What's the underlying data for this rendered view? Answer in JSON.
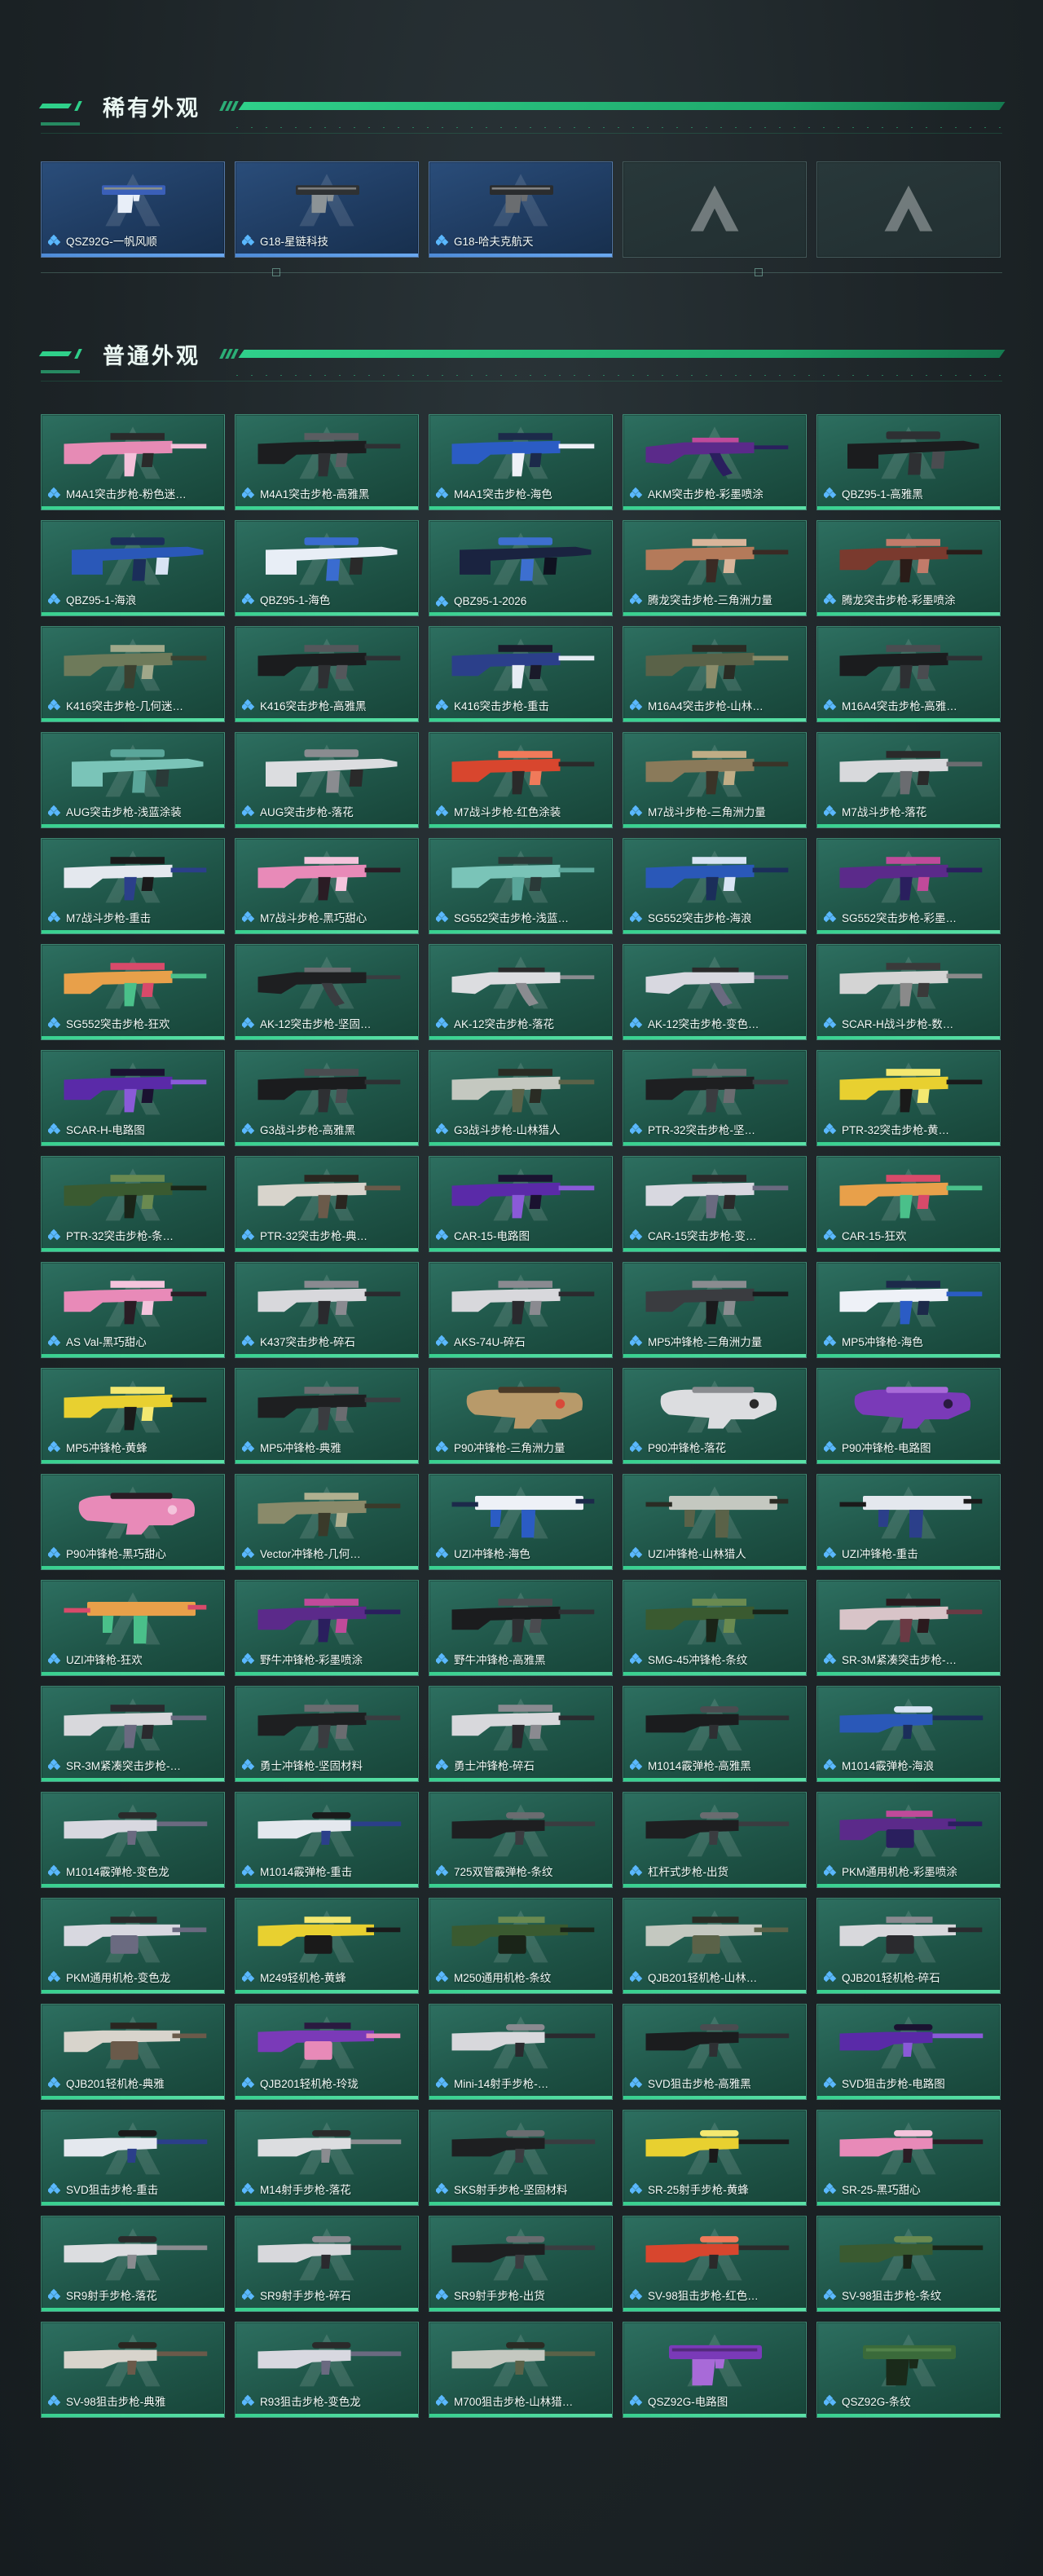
{
  "sections": {
    "rare": {
      "title": "稀有外观"
    },
    "common": {
      "title": "普通外观"
    }
  },
  "colors": {
    "accent": "#2fd08a",
    "card_common": "#25604f",
    "card_rare": "#24456d",
    "rarity_dots": "#5ab8ff"
  },
  "icons": {
    "rarity": "rarity-diamond-icon",
    "placeholder": "brand-logo-icon"
  },
  "rare_items": [
    {
      "label": "QSZ92G-一帆风顺",
      "gun_type": "pistol",
      "palette": [
        "#3a5fb8",
        "#e8eef8",
        "#d7c15a"
      ]
    },
    {
      "label": "G18-星链科技",
      "gun_type": "pistol",
      "palette": [
        "#2e3133",
        "#8c9396",
        "#c9cccc"
      ]
    },
    {
      "label": "G18-哈夫克航天",
      "gun_type": "pistol",
      "palette": [
        "#2a2c2e",
        "#6a6d70",
        "#d9d9d9"
      ]
    },
    {
      "label": "",
      "gun_type": "empty"
    },
    {
      "label": "",
      "gun_type": "empty"
    }
  ],
  "common_items": [
    {
      "label": "M4A1突击步枪-粉色迷…",
      "gun_type": "rifle",
      "palette": [
        "#e68bb5",
        "#f4c1da",
        "#2a2a2a"
      ]
    },
    {
      "label": "M4A1突击步枪-高雅黑",
      "gun_type": "rifle",
      "palette": [
        "#1c1d1f",
        "#2e3033",
        "#5a5d61"
      ]
    },
    {
      "label": "M4A1突击步枪-海色",
      "gun_type": "rifle",
      "palette": [
        "#2b5cc4",
        "#eef1f7",
        "#1c2a4a"
      ]
    },
    {
      "label": "AKM突击步枪-彩墨喷涂",
      "gun_type": "ak",
      "palette": [
        "#5b2a8a",
        "#2a1f5e",
        "#c04a9a"
      ]
    },
    {
      "label": "QBZ95-1-高雅黑",
      "gun_type": "bullpup",
      "palette": [
        "#1b1c1e",
        "#2e3033",
        "#4a4c50"
      ]
    },
    {
      "label": "QBZ95-1-海浪",
      "gun_type": "bullpup",
      "palette": [
        "#2a58b8",
        "#1b2e5a",
        "#d8e4f4"
      ]
    },
    {
      "label": "QBZ95-1-海色",
      "gun_type": "bullpup",
      "palette": [
        "#e8eef6",
        "#3a6cd0",
        "#2a2a2a"
      ]
    },
    {
      "label": "QBZ95-1-2026",
      "gun_type": "bullpup",
      "palette": [
        "#1a2340",
        "#3d6fd0",
        "#0f1220"
      ]
    },
    {
      "label": "腾龙突击步枪-三角洲力量",
      "gun_type": "rifle",
      "palette": [
        "#b47a5a",
        "#3a2a24",
        "#d9b59a"
      ]
    },
    {
      "label": "腾龙突击步枪-彩墨喷涂",
      "gun_type": "rifle",
      "palette": [
        "#7a3a2e",
        "#2a1c18",
        "#c27b6a"
      ]
    },
    {
      "label": "K416突击步枪-几何迷…",
      "gun_type": "rifle",
      "palette": [
        "#6e7a5a",
        "#3a4030",
        "#a0a88a"
      ]
    },
    {
      "label": "K416突击步枪-高雅黑",
      "gun_type": "rifle",
      "palette": [
        "#1b1c1e",
        "#2e3033",
        "#54575b"
      ]
    },
    {
      "label": "K416突击步枪-重击",
      "gun_type": "rifle",
      "palette": [
        "#2b3f8a",
        "#e6ecf4",
        "#1a1a2a"
      ]
    },
    {
      "label": "M16A4突击步枪-山林…",
      "gun_type": "rifle",
      "palette": [
        "#5a6248",
        "#8a8c6a",
        "#2a2c24"
      ]
    },
    {
      "label": "M16A4突击步枪-高雅…",
      "gun_type": "rifle",
      "palette": [
        "#1b1c1e",
        "#2e3033",
        "#4a4c50"
      ]
    },
    {
      "label": "AUG突击步枪-浅蓝涂装",
      "gun_type": "aug",
      "palette": [
        "#7ac4b8",
        "#5aa69a",
        "#2a3a38"
      ]
    },
    {
      "label": "AUG突击步枪-落花",
      "gun_type": "aug",
      "palette": [
        "#dcdde0",
        "#8a8c90",
        "#2a2a2a"
      ]
    },
    {
      "label": "M7战斗步枪-红色涂装",
      "gun_type": "rifle",
      "palette": [
        "#d8462e",
        "#2a2a2a",
        "#f07a5a"
      ]
    },
    {
      "label": "M7战斗步枪-三角洲力量",
      "gun_type": "rifle",
      "palette": [
        "#8a7a5a",
        "#3a3428",
        "#c0ad86"
      ]
    },
    {
      "label": "M7战斗步枪-落花",
      "gun_type": "rifle",
      "palette": [
        "#d8d9dc",
        "#6a6c70",
        "#2a2a2a"
      ]
    },
    {
      "label": "M7战斗步枪-重击",
      "gun_type": "rifle",
      "palette": [
        "#e4e8ee",
        "#2b3f8a",
        "#1a1a1a"
      ]
    },
    {
      "label": "M7战斗步枪-黑巧甜心",
      "gun_type": "rifle",
      "palette": [
        "#e88ab8",
        "#2a1c24",
        "#f4c4dc"
      ]
    },
    {
      "label": "SG552突击步枪-浅蓝…",
      "gun_type": "smg",
      "palette": [
        "#7ac4b8",
        "#5aa69a",
        "#2a3a38"
      ]
    },
    {
      "label": "SG552突击步枪-海浪",
      "gun_type": "smg",
      "palette": [
        "#2a58b8",
        "#1b2e5a",
        "#d8e4f4"
      ]
    },
    {
      "label": "SG552突击步枪-彩墨…",
      "gun_type": "smg",
      "palette": [
        "#5b2a8a",
        "#2a1f5e",
        "#c04a9a"
      ]
    },
    {
      "label": "SG552突击步枪-狂欢",
      "gun_type": "rifle",
      "palette": [
        "#e8a04a",
        "#4ac08a",
        "#d84a6a"
      ]
    },
    {
      "label": "AK-12突击步枪-坚固…",
      "gun_type": "ak",
      "palette": [
        "#1e1f21",
        "#3a3c40",
        "#6a6c70"
      ]
    },
    {
      "label": "AK-12突击步枪-落花",
      "gun_type": "ak",
      "palette": [
        "#dcdde0",
        "#8a8c90",
        "#2a2a2a"
      ]
    },
    {
      "label": "AK-12突击步枪-变色…",
      "gun_type": "ak",
      "palette": [
        "#d8d8e0",
        "#6a6a80",
        "#2a2a2a"
      ]
    },
    {
      "label": "SCAR-H战斗步枪-数…",
      "gun_type": "rifle",
      "palette": [
        "#d4d4d4",
        "#8a8a8a",
        "#3a3a3a"
      ]
    },
    {
      "label": "SCAR-H-电路图",
      "gun_type": "rifle",
      "palette": [
        "#5a2aa8",
        "#8a5ad8",
        "#1a1230"
      ]
    },
    {
      "label": "G3战斗步枪-高雅黑",
      "gun_type": "rifle",
      "palette": [
        "#1b1c1e",
        "#2e3033",
        "#4a4c50"
      ]
    },
    {
      "label": "G3战斗步枪-山林猎人",
      "gun_type": "rifle",
      "palette": [
        "#c4c8c0",
        "#5a6248",
        "#2a2c24"
      ]
    },
    {
      "label": "PTR-32突击步枪-坚…",
      "gun_type": "rifle",
      "palette": [
        "#1e1f21",
        "#3a3c40",
        "#6a6c70"
      ]
    },
    {
      "label": "PTR-32突击步枪-黄…",
      "gun_type": "rifle",
      "palette": [
        "#e8d030",
        "#1a1a1a",
        "#f4e870"
      ]
    },
    {
      "label": "PTR-32突击步枪-条…",
      "gun_type": "rifle",
      "palette": [
        "#3a5a30",
        "#1a2418",
        "#6a8a50"
      ]
    },
    {
      "label": "PTR-32突击步枪-典…",
      "gun_type": "rifle",
      "palette": [
        "#d8d4cc",
        "#6a5a4a",
        "#2a2620"
      ]
    },
    {
      "label": "CAR-15-电路图",
      "gun_type": "rifle",
      "palette": [
        "#5a2aa8",
        "#8a5ad8",
        "#1a1230"
      ]
    },
    {
      "label": "CAR-15突击步枪-变…",
      "gun_type": "rifle",
      "palette": [
        "#d8d8e0",
        "#6a6a80",
        "#2a2a2a"
      ]
    },
    {
      "label": "CAR-15-狂欢",
      "gun_type": "rifle",
      "palette": [
        "#e8a04a",
        "#4ac08a",
        "#d84a6a"
      ]
    },
    {
      "label": "AS Val-黑巧甜心",
      "gun_type": "rifle",
      "palette": [
        "#e88ab8",
        "#2a1c24",
        "#f4c4dc"
      ]
    },
    {
      "label": "K437突击步枪-碎石",
      "gun_type": "rifle",
      "palette": [
        "#d8d8dc",
        "#2a2a2e",
        "#8a8a90"
      ]
    },
    {
      "label": "AKS-74U-碎石",
      "gun_type": "smg",
      "palette": [
        "#d8d8dc",
        "#2a2a2e",
        "#8a8a90"
      ]
    },
    {
      "label": "MP5冲锋枪-三角洲力量",
      "gun_type": "smg",
      "palette": [
        "#3a3c40",
        "#1a1a1c",
        "#8a8c90"
      ]
    },
    {
      "label": "MP5冲锋枪-海色",
      "gun_type": "smg",
      "palette": [
        "#eef1f7",
        "#2b5cc4",
        "#1c2a4a"
      ]
    },
    {
      "label": "MP5冲锋枪-黄蜂",
      "gun_type": "smg",
      "palette": [
        "#e8d030",
        "#1a1a1a",
        "#f4e870"
      ]
    },
    {
      "label": "MP5冲锋枪-典雅",
      "gun_type": "smg",
      "palette": [
        "#1e1f21",
        "#3a3c40",
        "#6a6c70"
      ]
    },
    {
      "label": "P90冲锋枪-三角洲力量",
      "gun_type": "p90",
      "palette": [
        "#b89a6a",
        "#4a3a28",
        "#d84a3a"
      ]
    },
    {
      "label": "P90冲锋枪-落花",
      "gun_type": "p90",
      "palette": [
        "#dcdde0",
        "#8a8c90",
        "#2a2a2a"
      ]
    },
    {
      "label": "P90冲锋枪-电路图",
      "gun_type": "p90",
      "palette": [
        "#7a3ab8",
        "#a86ad8",
        "#2a1a40"
      ]
    },
    {
      "label": "P90冲锋枪-黑巧甜心",
      "gun_type": "p90",
      "palette": [
        "#e88ab8",
        "#2a1c24",
        "#f4c4dc"
      ]
    },
    {
      "label": "Vector冲锋枪-几何…",
      "gun_type": "smg",
      "palette": [
        "#8a8a6a",
        "#3a3a2a",
        "#b0b090"
      ]
    },
    {
      "label": "UZI冲锋枪-海色",
      "gun_type": "uzi",
      "palette": [
        "#eef1f7",
        "#2b5cc4",
        "#1c2a4a"
      ]
    },
    {
      "label": "UZI冲锋枪-山林猎人",
      "gun_type": "uzi",
      "palette": [
        "#c4c8c0",
        "#5a6248",
        "#2a2c24"
      ]
    },
    {
      "label": "UZI冲锋枪-重击",
      "gun_type": "uzi",
      "palette": [
        "#e4e8ee",
        "#2b3f8a",
        "#1a1a1a"
      ]
    },
    {
      "label": "UZI冲锋枪-狂欢",
      "gun_type": "uzi",
      "palette": [
        "#e8a04a",
        "#4ac08a",
        "#d84a6a"
      ]
    },
    {
      "label": "野牛冲锋枪-彩墨喷涂",
      "gun_type": "rifle",
      "palette": [
        "#5b2a8a",
        "#2a1f5e",
        "#c04a9a"
      ]
    },
    {
      "label": "野牛冲锋枪-高雅黑",
      "gun_type": "rifle",
      "palette": [
        "#1b1c1e",
        "#2e3033",
        "#4a4c50"
      ]
    },
    {
      "label": "SMG-45冲锋枪-条纹",
      "gun_type": "smg",
      "palette": [
        "#3a5a30",
        "#1a2418",
        "#6a8a50"
      ]
    },
    {
      "label": "SR-3M紧凑突击步枪-…",
      "gun_type": "rifle",
      "palette": [
        "#d8c4c8",
        "#6a3a44",
        "#2a1a1e"
      ]
    },
    {
      "label": "SR-3M紧凑突击步枪-…",
      "gun_type": "smg",
      "palette": [
        "#d8d8dc",
        "#6a6a80",
        "#2a2a2e"
      ]
    },
    {
      "label": "勇士冲锋枪-坚固材料",
      "gun_type": "smg",
      "palette": [
        "#1e1f21",
        "#3a3c40",
        "#6a6c70"
      ]
    },
    {
      "label": "勇士冲锋枪-碎石",
      "gun_type": "smg",
      "palette": [
        "#d8d8dc",
        "#2a2a2e",
        "#8a8a90"
      ]
    },
    {
      "label": "M1014霰弹枪-高雅黑",
      "gun_type": "shotgun",
      "palette": [
        "#1b1c1e",
        "#2e3033",
        "#4a4c50"
      ]
    },
    {
      "label": "M1014霰弹枪-海浪",
      "gun_type": "shotgun",
      "palette": [
        "#2a58b8",
        "#1b2e5a",
        "#d8e4f4"
      ]
    },
    {
      "label": "M1014霰弹枪-变色龙",
      "gun_type": "shotgun",
      "palette": [
        "#d8d8e0",
        "#6a6a80",
        "#2a2a2a"
      ]
    },
    {
      "label": "M1014霰弹枪-重击",
      "gun_type": "shotgun",
      "palette": [
        "#e4e8ee",
        "#2b3f8a",
        "#1a1a1a"
      ]
    },
    {
      "label": "725双管霰弹枪-条纹",
      "gun_type": "shotgun",
      "palette": [
        "#1e1f21",
        "#3a3c40",
        "#6a6c70"
      ]
    },
    {
      "label": "杠杆式步枪-出货",
      "gun_type": "sniper",
      "palette": [
        "#1e1f21",
        "#3a3c40",
        "#6a6c70"
      ]
    },
    {
      "label": "PKM通用机枪-彩墨喷涂",
      "gun_type": "lmg",
      "palette": [
        "#5b2a8a",
        "#2a1f5e",
        "#c04a9a"
      ]
    },
    {
      "label": "PKM通用机枪-变色龙",
      "gun_type": "lmg",
      "palette": [
        "#d8d8e0",
        "#6a6a80",
        "#2a2a2a"
      ]
    },
    {
      "label": "M249轻机枪-黄蜂",
      "gun_type": "lmg",
      "palette": [
        "#e8d030",
        "#1a1a1a",
        "#f4e870"
      ]
    },
    {
      "label": "M250通用机枪-条纹",
      "gun_type": "lmg",
      "palette": [
        "#3a5a30",
        "#1a2418",
        "#6a8a50"
      ]
    },
    {
      "label": "QJB201轻机枪-山林…",
      "gun_type": "lmg",
      "palette": [
        "#c4c8c0",
        "#5a6248",
        "#2a2c24"
      ]
    },
    {
      "label": "QJB201轻机枪-碎石",
      "gun_type": "lmg",
      "palette": [
        "#d8d8dc",
        "#2a2a2e",
        "#8a8a90"
      ]
    },
    {
      "label": "QJB201轻机枪-典雅",
      "gun_type": "lmg",
      "palette": [
        "#d8d4cc",
        "#6a5a4a",
        "#2a2620"
      ]
    },
    {
      "label": "QJB201轻机枪-玲珑",
      "gun_type": "lmg",
      "palette": [
        "#7a3ab8",
        "#e88ab8",
        "#2a1a40"
      ]
    },
    {
      "label": "Mini-14射手步枪-…",
      "gun_type": "sniper",
      "palette": [
        "#d8d8dc",
        "#2a2a2e",
        "#8a8a90"
      ]
    },
    {
      "label": "SVD狙击步枪-高雅黑",
      "gun_type": "sniper",
      "palette": [
        "#1b1c1e",
        "#2e3033",
        "#4a4c50"
      ]
    },
    {
      "label": "SVD狙击步枪-电路图",
      "gun_type": "sniper",
      "palette": [
        "#5a2aa8",
        "#8a5ad8",
        "#1a1230"
      ]
    },
    {
      "label": "SVD狙击步枪-重击",
      "gun_type": "sniper",
      "palette": [
        "#e4e8ee",
        "#2b3f8a",
        "#1a1a1a"
      ]
    },
    {
      "label": "M14射手步枪-落花",
      "gun_type": "sniper",
      "palette": [
        "#dcdde0",
        "#8a8c90",
        "#2a2a2a"
      ]
    },
    {
      "label": "SKS射手步枪-坚固材料",
      "gun_type": "sniper",
      "palette": [
        "#1e1f21",
        "#3a3c40",
        "#6a6c70"
      ]
    },
    {
      "label": "SR-25射手步枪-黄蜂",
      "gun_type": "sniper",
      "palette": [
        "#e8d030",
        "#1a1a1a",
        "#f4e870"
      ]
    },
    {
      "label": "SR-25-黑巧甜心",
      "gun_type": "sniper",
      "palette": [
        "#e88ab8",
        "#2a1c24",
        "#f4c4dc"
      ]
    },
    {
      "label": "SR9射手步枪-落花",
      "gun_type": "sniper",
      "palette": [
        "#dcdde0",
        "#8a8c90",
        "#2a2a2a"
      ]
    },
    {
      "label": "SR9射手步枪-碎石",
      "gun_type": "sniper",
      "palette": [
        "#d8d8dc",
        "#2a2a2e",
        "#8a8a90"
      ]
    },
    {
      "label": "SR9射手步枪-出货",
      "gun_type": "sniper",
      "palette": [
        "#1e1f21",
        "#3a3c40",
        "#6a6c70"
      ]
    },
    {
      "label": "SV-98狙击步枪-红色…",
      "gun_type": "sniper",
      "palette": [
        "#d8462e",
        "#2a2a2a",
        "#f07a5a"
      ]
    },
    {
      "label": "SV-98狙击步枪-条纹",
      "gun_type": "sniper",
      "palette": [
        "#3a5a30",
        "#1a2418",
        "#6a8a50"
      ]
    },
    {
      "label": "SV-98狙击步枪-典雅",
      "gun_type": "sniper",
      "palette": [
        "#d8d4cc",
        "#6a5a4a",
        "#2a2620"
      ]
    },
    {
      "label": "R93狙击步枪-变色龙",
      "gun_type": "sniper",
      "palette": [
        "#d8d8e0",
        "#6a6a80",
        "#2a2a2a"
      ]
    },
    {
      "label": "M700狙击步枪-山林猎…",
      "gun_type": "sniper",
      "palette": [
        "#c4c8c0",
        "#5a6248",
        "#2a2c24"
      ]
    },
    {
      "label": "QSZ92G-电路图",
      "gun_type": "pistol",
      "palette": [
        "#7a3ab8",
        "#a86ad8",
        "#2a1a40"
      ]
    },
    {
      "label": "QSZ92G-条纹",
      "gun_type": "pistol",
      "palette": [
        "#3a6a3a",
        "#1a2a1a",
        "#6a9a5a"
      ]
    }
  ]
}
